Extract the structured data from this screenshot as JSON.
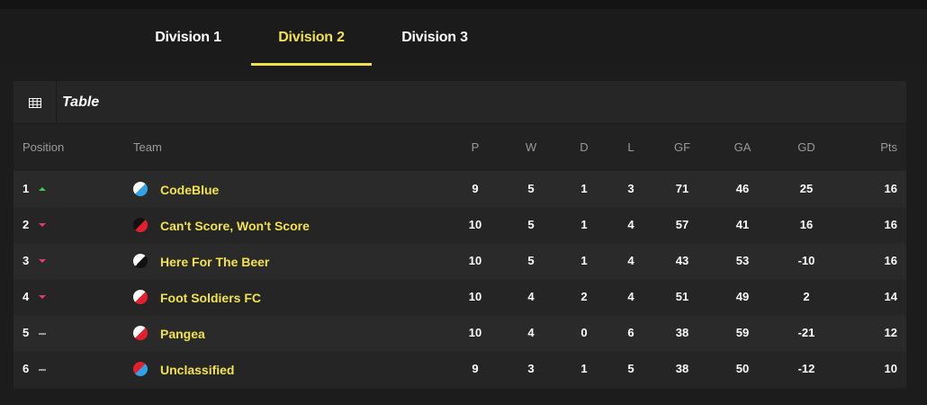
{
  "tabs": [
    {
      "label": "Division 1",
      "active": false
    },
    {
      "label": "Division 2",
      "active": true
    },
    {
      "label": "Division 3",
      "active": false
    }
  ],
  "accent_color": "#f2e24a",
  "panel": {
    "icon": "table-grid-icon",
    "title": "Table"
  },
  "columns": {
    "position": "Position",
    "team": "Team",
    "p": "P",
    "w": "W",
    "d": "D",
    "l": "L",
    "gf": "GF",
    "ga": "GA",
    "gd": "GD",
    "pts": "Pts"
  },
  "rows": [
    {
      "pos": "1",
      "trend": "up",
      "team": "CodeBlue",
      "badge": [
        "#ffffff",
        "#2fa3e6"
      ],
      "p": "9",
      "w": "5",
      "d": "1",
      "l": "3",
      "gf": "71",
      "ga": "46",
      "gd": "25",
      "pts": "16"
    },
    {
      "pos": "2",
      "trend": "down",
      "team": "Can't Score, Won't Score",
      "badge": [
        "#111111",
        "#e3202b"
      ],
      "p": "10",
      "w": "5",
      "d": "1",
      "l": "4",
      "gf": "57",
      "ga": "41",
      "gd": "16",
      "pts": "16"
    },
    {
      "pos": "3",
      "trend": "down",
      "team": "Here For The Beer",
      "badge": [
        "#ffffff",
        "#111111"
      ],
      "p": "10",
      "w": "5",
      "d": "1",
      "l": "4",
      "gf": "43",
      "ga": "53",
      "gd": "-10",
      "pts": "16"
    },
    {
      "pos": "4",
      "trend": "down",
      "team": "Foot Soldiers FC",
      "badge": [
        "#ffffff",
        "#e3202b"
      ],
      "p": "10",
      "w": "4",
      "d": "2",
      "l": "4",
      "gf": "51",
      "ga": "49",
      "gd": "2",
      "pts": "14"
    },
    {
      "pos": "5",
      "trend": "same",
      "team": "Pangea",
      "badge": [
        "#ffffff",
        "#e3202b"
      ],
      "p": "10",
      "w": "4",
      "d": "0",
      "l": "6",
      "gf": "38",
      "ga": "59",
      "gd": "-21",
      "pts": "12"
    },
    {
      "pos": "6",
      "trend": "same",
      "team": "Unclassified",
      "badge": [
        "#e3202b",
        "#2fa3e6"
      ],
      "p": "9",
      "w": "3",
      "d": "1",
      "l": "5",
      "gf": "38",
      "ga": "50",
      "gd": "-12",
      "pts": "10"
    }
  ]
}
